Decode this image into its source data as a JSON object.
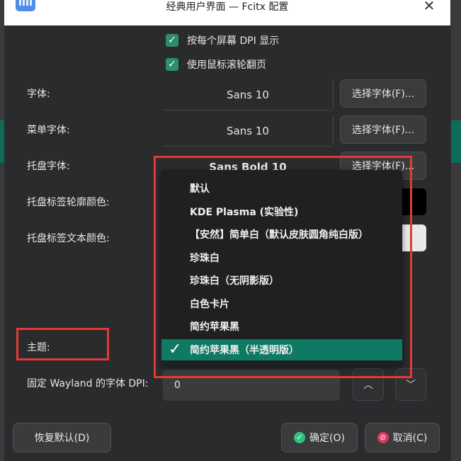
{
  "window": {
    "title": "经典用户界面 — Fcitx 配置",
    "close_glyph": "✕"
  },
  "checkboxes": [
    {
      "label": "按每个屏幕 DPI 显示",
      "checked": true
    },
    {
      "label": "使用鼠标滚轮翻页",
      "checked": true
    }
  ],
  "labels": {
    "font": "字体:",
    "menu_font": "菜单字体:",
    "tray_font": "托盘字体:",
    "tray_outline_color": "托盘标签轮廓颜色:",
    "tray_text_color": "托盘标签文本颜色:",
    "theme": "主题:",
    "wayland_dpi": "固定 Wayland 的字体 DPI:"
  },
  "fields": {
    "font_value": "Sans 10",
    "menu_font_value": "Sans 10",
    "tray_font_value": "Sans Bold 10",
    "select_font_label": "选择字体(F)...",
    "wayland_dpi_value": "0"
  },
  "colors": {
    "tray_outline": "#000000",
    "tray_text": "#ffffff",
    "accent": "#0f7a63",
    "annotation": "#e53935"
  },
  "theme_dropdown": {
    "items": [
      "默认",
      "KDE Plasma (实验性)",
      "【安然】简单白（默认皮肤圆角纯白版）",
      "珍珠白",
      "珍珠白（无阴影版）",
      "白色卡片",
      "简约苹果黑",
      "简约苹果黑（半透明版）"
    ],
    "selected_index": 7,
    "check_glyph": "✓"
  },
  "spinner": {
    "up_glyph": "︿",
    "down_glyph": "﹀"
  },
  "buttons": {
    "restore_defaults": "恢复默认(D)",
    "ok": "确定(O)",
    "cancel": "取消(C)",
    "ok_glyph": "✓",
    "cancel_glyph": "⊘"
  }
}
